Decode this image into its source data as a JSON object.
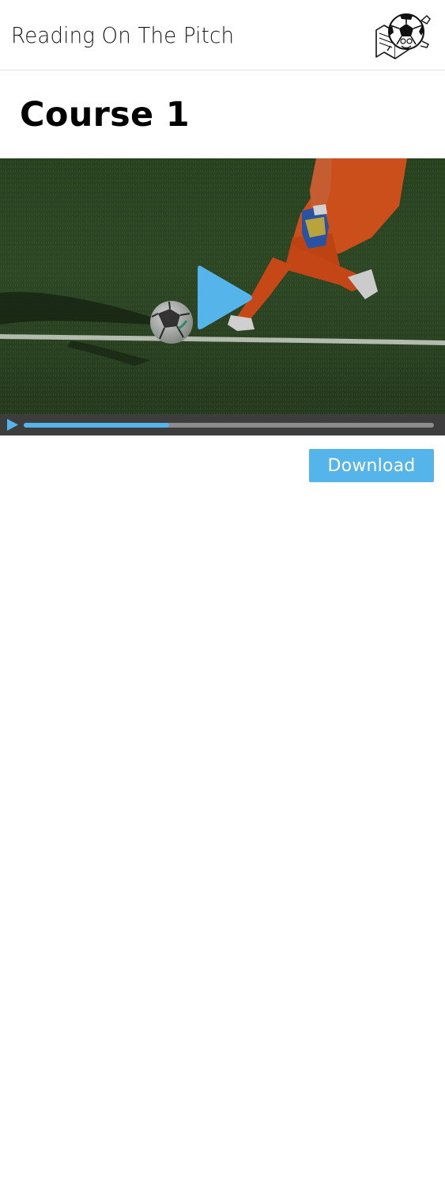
{
  "header": {
    "title": "Reading On The Pitch",
    "logo_icon": "soccer-ball-reading-book-logo"
  },
  "page": {
    "title": "Course 1"
  },
  "video": {
    "thumbnail": "goalkeeper-kicking-soccer-ball-on-grass",
    "play_icon": "play-icon",
    "progress_percent": 35.5,
    "accent_color": "#55b4e9",
    "control_bar_color": "#3d3d3d"
  },
  "actions": {
    "download_label": "Download",
    "download_color": "#55b4e9"
  }
}
